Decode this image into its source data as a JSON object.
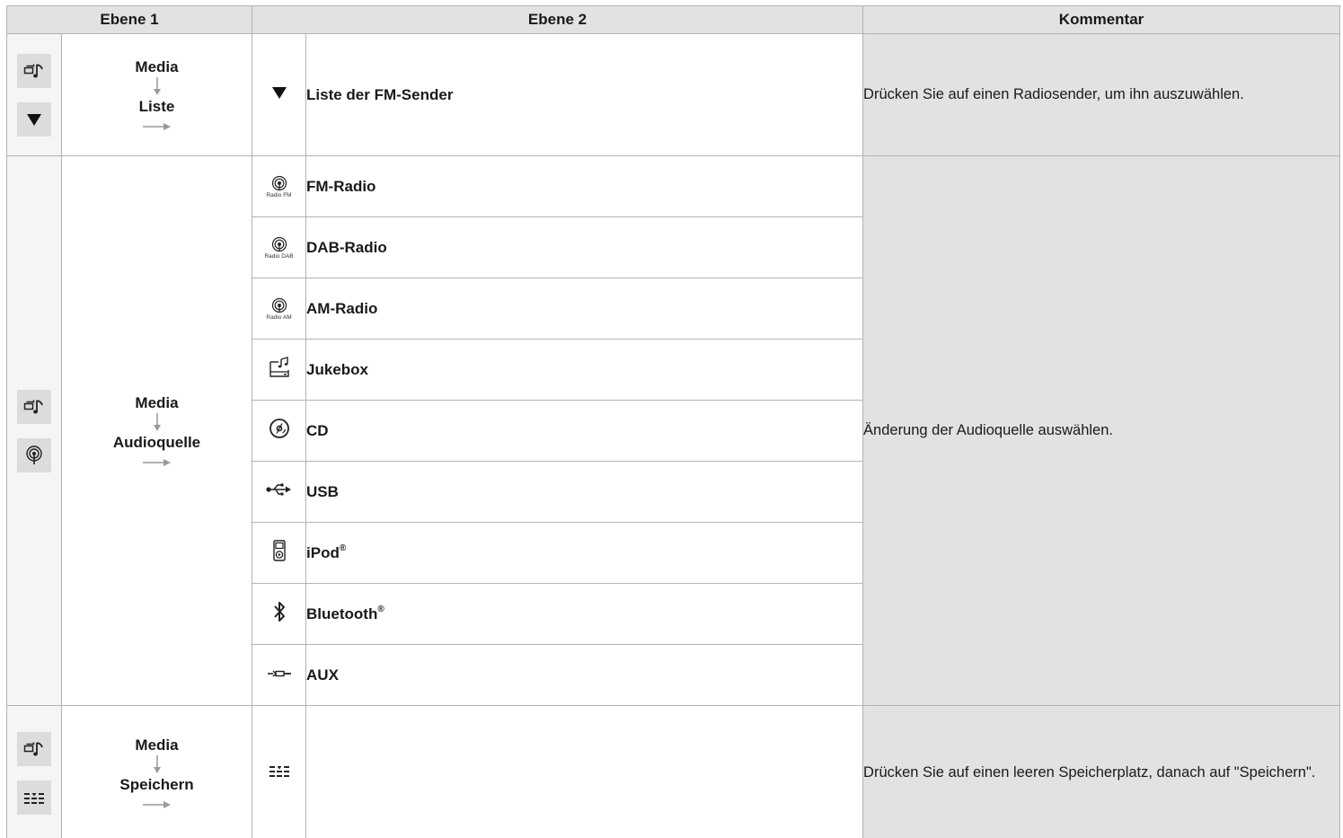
{
  "headers": {
    "level1": "Ebene 1",
    "level2": "Ebene 2",
    "comment": "Kommentar"
  },
  "sections": [
    {
      "path_top": "Media",
      "path_bottom": "Liste",
      "icons_level1": [
        "media-icon",
        "dropdown-triangle-icon"
      ],
      "items": [
        {
          "icon": "dropdown-triangle-icon",
          "label": "Liste der FM-Sender"
        }
      ],
      "comment": "Drücken Sie auf einen Radiosender, um ihn auszuwählen."
    },
    {
      "path_top": "Media",
      "path_bottom": "Audioquelle",
      "icons_level1": [
        "media-icon",
        "radio-source-icon"
      ],
      "items": [
        {
          "icon": "radio-fm-icon",
          "icon_caption": "Radio FM",
          "label": "FM-Radio"
        },
        {
          "icon": "radio-dab-icon",
          "icon_caption": "Radio DAB",
          "label": "DAB-Radio"
        },
        {
          "icon": "radio-am-icon",
          "icon_caption": "Radio AM",
          "label": "AM-Radio"
        },
        {
          "icon": "jukebox-icon",
          "label": "Jukebox"
        },
        {
          "icon": "cd-icon",
          "label": "CD"
        },
        {
          "icon": "usb-icon",
          "label": "USB"
        },
        {
          "icon": "ipod-icon",
          "label": "iPod",
          "mark": "®"
        },
        {
          "icon": "bluetooth-icon",
          "label": "Bluetooth",
          "mark": "®"
        },
        {
          "icon": "aux-icon",
          "label": "AUX"
        }
      ],
      "comment": "Änderung der Audioquelle auswählen."
    },
    {
      "path_top": "Media",
      "path_bottom": "Speichern",
      "icons_level1": [
        "media-icon",
        "presets-icon"
      ],
      "items": [
        {
          "icon": "presets-icon",
          "label": ""
        }
      ],
      "comment": "Drücken Sie auf einen leeren Speicherplatz, danach auf \"Speichern\"."
    }
  ]
}
